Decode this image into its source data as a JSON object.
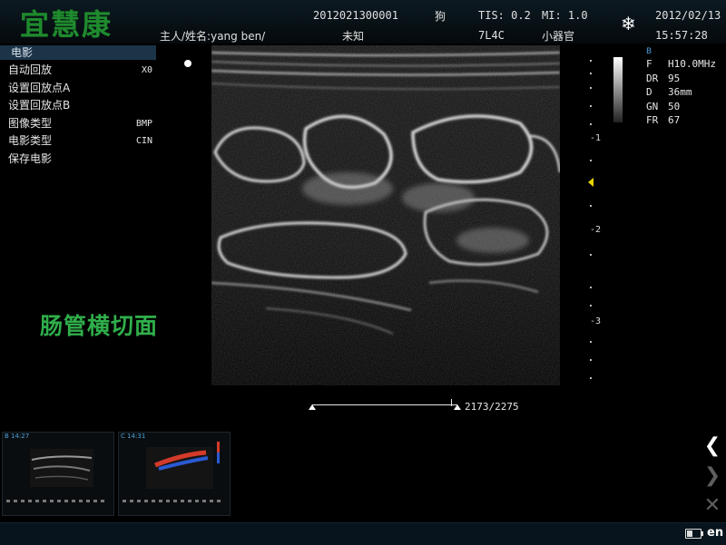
{
  "header": {
    "logo": "宜慧康",
    "patient_id": "2012021300001",
    "species": "狗",
    "tis": "TIS: 0.2",
    "mi": "MI: 1.0",
    "date": "2012/02/13",
    "owner_name": "主人/姓名:yang ben/",
    "unknown": "未知",
    "probe": "7L4C",
    "exam_type": "小器官",
    "time": "15:57:28",
    "freeze_icon": "snowflake-icon"
  },
  "cine_menu": {
    "title": "电影",
    "items": [
      {
        "label": "自动回放",
        "value": "X0"
      },
      {
        "label": "设置回放点A",
        "value": ""
      },
      {
        "label": "设置回放点B",
        "value": ""
      },
      {
        "label": "图像类型",
        "value": "BMP"
      },
      {
        "label": "电影类型",
        "value": "CIN"
      },
      {
        "label": "保存电影",
        "value": ""
      }
    ]
  },
  "annotation": "肠管横切面",
  "depth_scale": {
    "labels": [
      "-1",
      "-2",
      "-3"
    ],
    "marker_color": "#e6d400"
  },
  "params": {
    "mode": "B",
    "rows": [
      {
        "key": "F",
        "value": "H10.0MHz"
      },
      {
        "key": "DR",
        "value": "95"
      },
      {
        "key": "D",
        "value": "36mm"
      },
      {
        "key": "GN",
        "value": "50"
      },
      {
        "key": "FR",
        "value": "67"
      }
    ]
  },
  "cine": {
    "frame_counter": "2173/2275",
    "position": 0.955
  },
  "thumbnails": [
    {
      "label": "B  14:27",
      "type": "bmode"
    },
    {
      "label": "C  14:31",
      "type": "color"
    }
  ],
  "side_buttons": {
    "prev_icon": "chevron-left-icon",
    "next_icon": "chevron-right-icon",
    "close_icon": "close-icon"
  },
  "footer": {
    "battery_level": 0.45,
    "language": "en"
  },
  "colors": {
    "logo": "#1f8a2e",
    "annotation": "#2fae4a",
    "menu_title_bg": "#1c3448",
    "param_header": "#4aa0d8"
  }
}
